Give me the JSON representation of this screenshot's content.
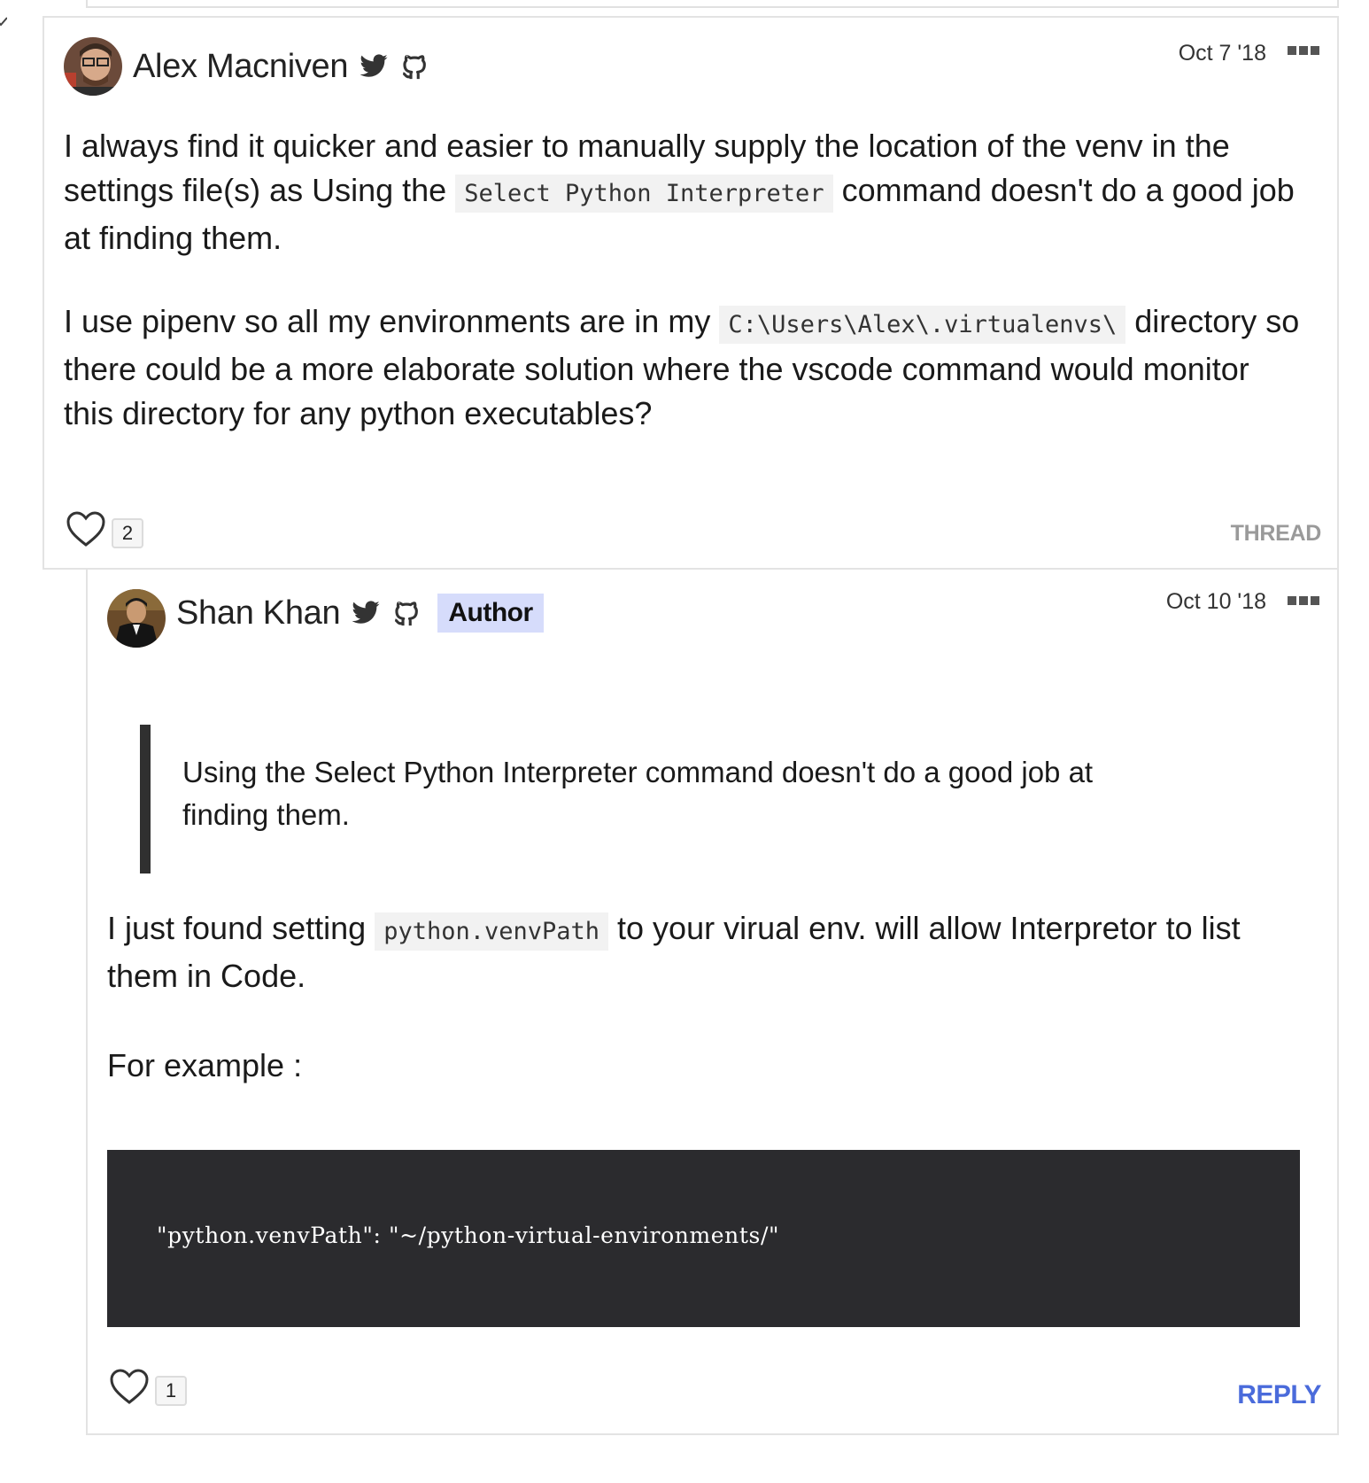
{
  "comments": [
    {
      "author": "Alex Macniven",
      "date": "Oct 7 '18",
      "paragraphs": [
        {
          "before": "I always find it quicker and easier to manually supply the location of the venv in the settings file(s) as Using the ",
          "code": "Select Python Interpreter",
          "after": " command doesn't do a good job at finding them."
        },
        {
          "before": "I use pipenv so all my environments are in my ",
          "code": "C:\\Users\\Alex\\.virtualenvs\\",
          "after": " directory so there could be a more elaborate solution where the vscode command would monitor this directory for any python executables?"
        }
      ],
      "likes": "2",
      "action_label": "THREAD"
    },
    {
      "author": "Shan Khan",
      "badge": "Author",
      "date": "Oct 10 '18",
      "quote": "Using the Select Python Interpreter command doesn't do a good job at finding them.",
      "paragraphs": [
        {
          "before": "I just found setting ",
          "code": "python.venvPath",
          "after": " to your virual env. will allow Interpretor to list them in Code."
        },
        {
          "before": "For example :",
          "code": "",
          "after": ""
        }
      ],
      "code_block": "\"python.venvPath\": \"~/python-virtual-environments/\"",
      "likes": "1",
      "action_label": "REPLY"
    }
  ],
  "icons": {
    "twitter": "twitter-icon",
    "github": "github-icon",
    "heart": "heart-icon",
    "more": "more-options-icon"
  },
  "colors": {
    "author_badge_bg": "#d6dcfb",
    "reply_link": "#4a6bdb",
    "thread_link": "#9a9a9a",
    "code_block_bg": "#2b2b2e",
    "inline_code_bg": "#f2f2f2"
  }
}
